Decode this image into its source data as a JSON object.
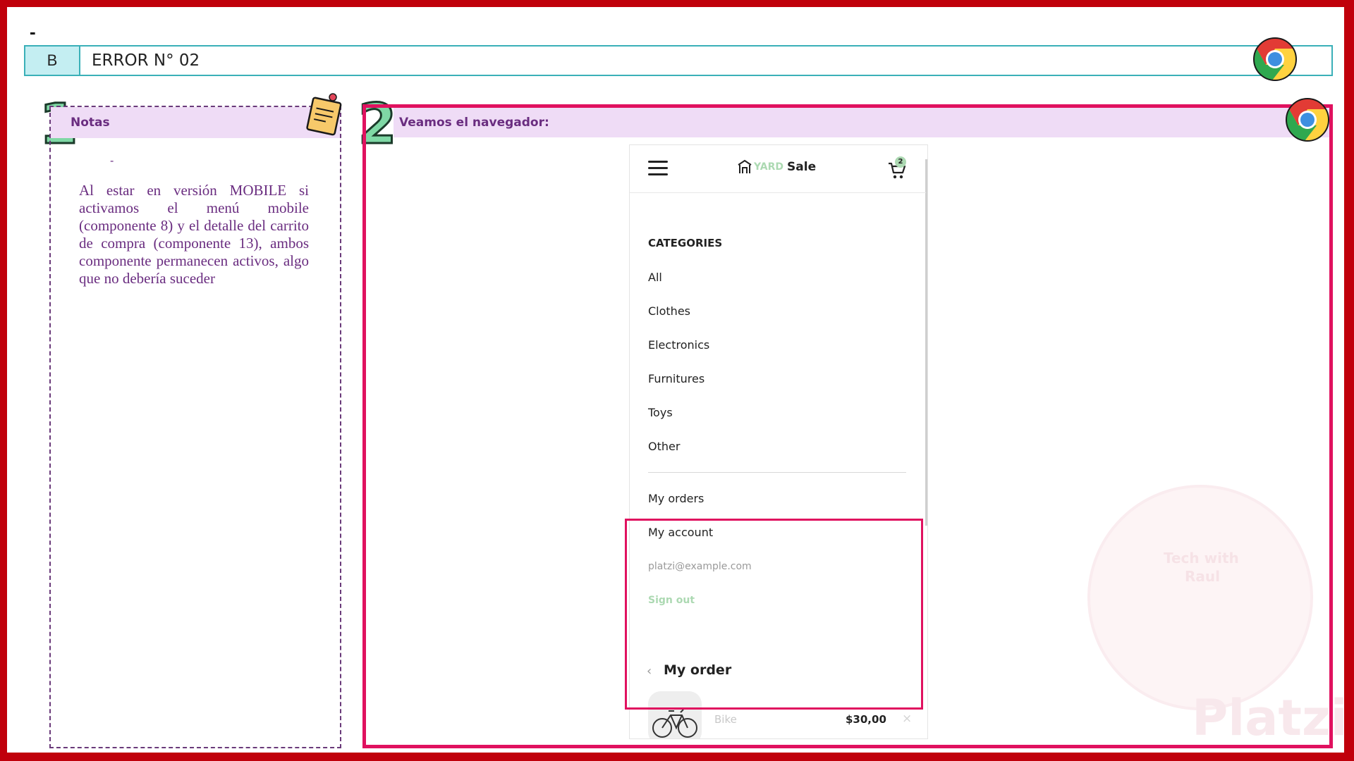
{
  "slide": {
    "top_dash": "-",
    "header": {
      "letter": "B",
      "title": "ERROR N° 02"
    },
    "step_numbers": [
      "1",
      "2"
    ]
  },
  "notes_panel": {
    "heading": "Notas",
    "dash": "-",
    "body": "Al estar en versión MOBILE si activamos el menú mobile (componente 8) y el detalle del carrito de compra  (componente 13), ambos componente permanecen activos, algo que no debería suceder"
  },
  "browser_panel": {
    "heading": "Veamos el navegador:"
  },
  "mobile_app": {
    "logo": {
      "yard": "YARD",
      "sale": "Sale"
    },
    "cart_count": "2",
    "categories_title": "CATEGORIES",
    "categories": [
      "All",
      "Clothes",
      "Electronics",
      "Furnitures",
      "Toys",
      "Other"
    ],
    "account_links": {
      "orders": "My orders",
      "account": "My account"
    },
    "email": "platzi@example.com",
    "sign_out": "Sign out",
    "order": {
      "back_icon": "‹",
      "title": "My order",
      "product": {
        "name": "Bike",
        "price": "$30,00",
        "remove_icon": "×"
      }
    }
  },
  "watermark": {
    "line1": "Tech with",
    "line2": "Raul",
    "brand": "Platzi"
  },
  "colors": {
    "frame": "#c0000b",
    "highlight": "#e0115f",
    "panel_heading_bg": "#efdcf6",
    "panel_heading_text": "#6a2d80",
    "header_accent": "#3ab0b8",
    "app_green": "#acd9b2"
  },
  "icons": [
    "chrome-icon",
    "sticky-note-icon",
    "hamburger-menu-icon",
    "storefront-icon",
    "shopping-cart-icon",
    "bike-icon"
  ]
}
